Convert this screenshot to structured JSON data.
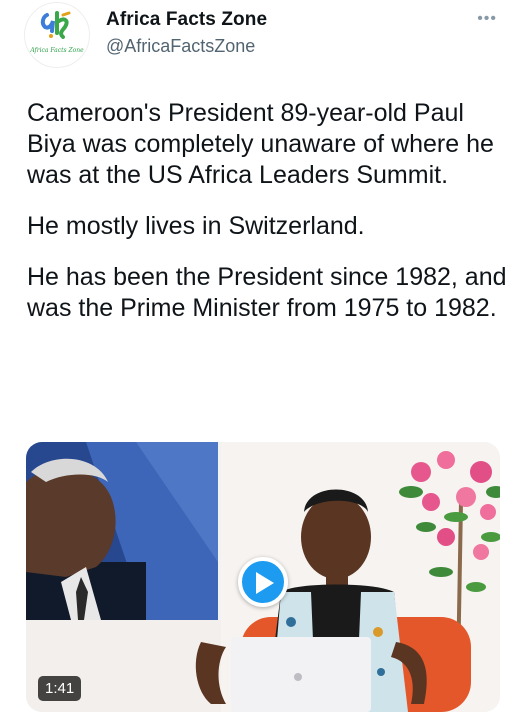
{
  "author": {
    "name": "Africa Facts Zone",
    "handle": "@AfricaFactsZone",
    "avatar_caption": "Africa Facts Zone",
    "avatar_icon": "africa-facts-zone-logo"
  },
  "more_icon": "more-dots-icon",
  "tweet": {
    "paragraphs": [
      "Cameroon's President 89-year-old Paul Biya was completely unaware of where he was at the US Africa Leaders Summit.",
      "He mostly lives in Switzerland.",
      "He has been the President since 1982, and was the Prime Minister from 1975 to 1982."
    ]
  },
  "media": {
    "duration": "1:41",
    "play_icon": "play-icon",
    "accent": "#1d9bf0"
  }
}
